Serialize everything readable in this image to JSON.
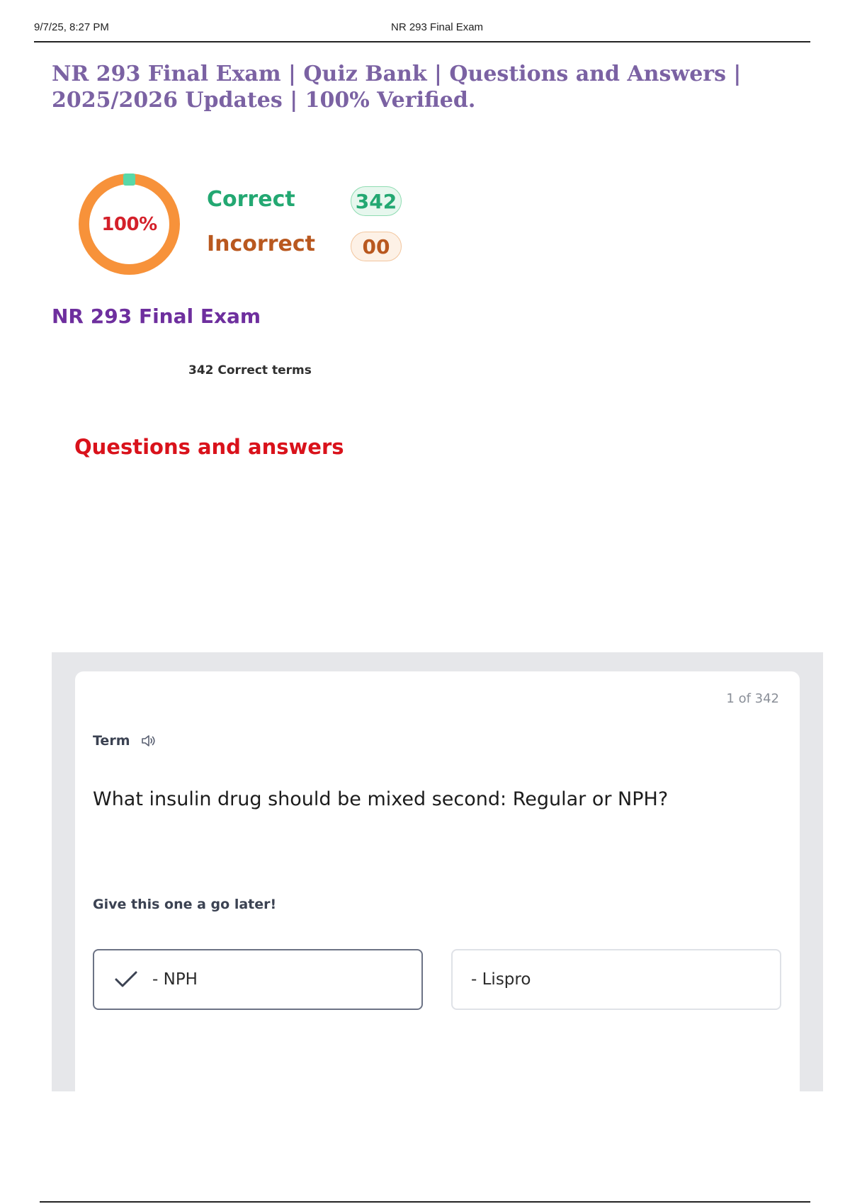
{
  "print_header": {
    "date": "9/7/25, 8:27 PM",
    "title": "NR 293 Final Exam"
  },
  "document": {
    "title": "NR 293 Final Exam | Quiz Bank | Questions and Answers | 2025/2026 Updates | 100% Verified."
  },
  "score": {
    "percent_label": "100%",
    "percent_value": 100,
    "ring_color": "#f7923a",
    "marker_color": "#58d8a8",
    "correct_label": "Correct",
    "correct_count": "342",
    "incorrect_label": "Incorrect",
    "incorrect_count": "00"
  },
  "set": {
    "title": "NR 293 Final Exam",
    "terms_count": "342 Correct terms",
    "qa_heading": "Questions and answers"
  },
  "card": {
    "counter": "1 of 342",
    "term_label": "Term",
    "speaker_icon": "speaker-icon",
    "question": "What insulin drug should be mixed second: Regular or NPH?",
    "later_text": "Give this one a go later!",
    "answers": [
      {
        "text": "- NPH",
        "selected": true,
        "icon": "check-icon"
      },
      {
        "text": "- Lispro",
        "selected": false
      }
    ]
  }
}
